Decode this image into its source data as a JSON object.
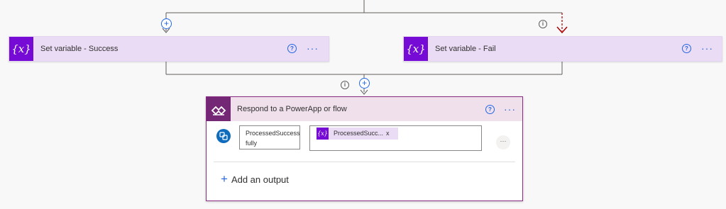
{
  "branches": {
    "success": {
      "title": "Set variable - Success",
      "icon": "variable-icon"
    },
    "fail": {
      "title": "Set variable - Fail",
      "icon": "variable-icon"
    }
  },
  "respond": {
    "title": "Respond to a PowerApp or flow",
    "output_name_line1": "ProcessedSuccess",
    "output_name_line2": "fully",
    "token_label": "ProcessedSucc...",
    "token_remove": "x",
    "add_output_label": "Add an output",
    "icon": "powerapps-icon"
  },
  "glyphs": {
    "help": "?",
    "more": "···",
    "info": "i",
    "add": "+",
    "variable": "{x}",
    "more_small": "···"
  },
  "colors": {
    "variable_accent": "#770bd6",
    "variable_card": "#eadcf5",
    "powerapps_accent": "#742774",
    "respond_header": "#efe0ec",
    "link_blue": "#2266e3",
    "run_after_failed": "#a80000"
  }
}
